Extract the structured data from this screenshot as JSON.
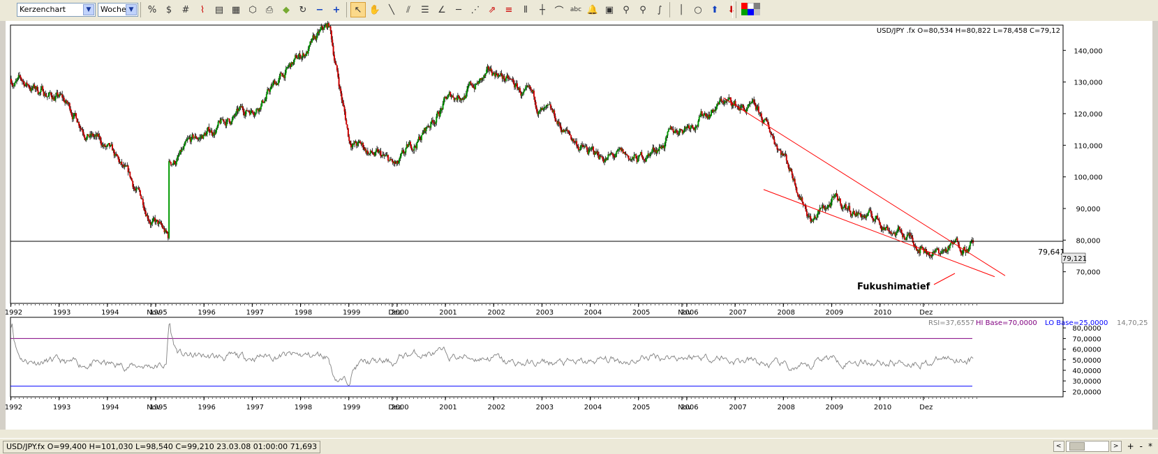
{
  "toolbar": {
    "chart_type": "Kerzenchart",
    "period": "Woche",
    "tools": [
      "percent-icon",
      "currency-icon",
      "grid-icon",
      "indicator-icon",
      "properties-icon",
      "template-icon",
      "open-icon",
      "print-icon",
      "color-icon",
      "refresh-icon",
      "zoom-minus-icon",
      "zoom-plus-icon",
      "cursor-icon",
      "hand-icon",
      "line-icon",
      "parallel-line-icon",
      "fibonacci-icon",
      "fan-icon",
      "arrow-tool-icon",
      "levels-icon",
      "vertical-lines-icon",
      "crosshair-icon",
      "arc-icon",
      "text-tool-icon",
      "alarm-icon",
      "calculator-icon",
      "zoom-in-icon",
      "zoom-area-icon",
      "freehand-icon",
      "vertical-line-icon",
      "circle-icon",
      "buy-arrow-icon",
      "sell-arrow-icon",
      "palette-icon"
    ]
  },
  "main_chart": {
    "info_line": "USD/JPY .fx O=80,534 H=80,822 L=78,458 C=79,12",
    "hline_label": "79,641",
    "last_price": "79,121",
    "annotation": "Fukushimatief",
    "colors": {
      "up": "#009900",
      "down": "#cc0000",
      "wick": "#000000",
      "trendline": "#ff0000",
      "hline": "#000000"
    }
  },
  "chart_data": [
    {
      "type": "candlestick",
      "title": "USD/JPY .fx",
      "ylim": [
        60000,
        148000
      ],
      "y_ticks": [
        "70,000",
        "80,000",
        "90,000",
        "100,000",
        "110,000",
        "120,000",
        "130,000",
        "140,000"
      ],
      "x_labels": [
        "1992",
        "1993",
        "1994",
        "Nov",
        "1995",
        "1996",
        "1997",
        "1998",
        "1999",
        "Dez",
        "2000",
        "2001",
        "2002",
        "2003",
        "2004",
        "2005",
        "Nov",
        "2006",
        "2007",
        "2008",
        "2009",
        "2010",
        "Dez"
      ],
      "horizontal_line": 79641,
      "trendlines": [
        {
          "from": [
            "2006-10",
            125000
          ],
          "to": [
            "2011-11",
            76000
          ]
        },
        {
          "from": [
            "2007-08",
            96000
          ],
          "to": [
            "2011-10",
            72000
          ]
        }
      ],
      "series": [
        {
          "x": [
            "1992",
            "1993",
            "1994",
            "1995-04",
            "1995",
            "1996",
            "1997",
            "1998-08",
            "1999",
            "2000",
            "2001",
            "2002-02",
            "2003",
            "2004",
            "2005",
            "2006",
            "2006-10",
            "2007-06",
            "2008",
            "2008-08",
            "2009",
            "2010",
            "2011-03",
            "2011-10"
          ],
          "values": [
            131000,
            125000,
            108000,
            80000,
            100000,
            113000,
            122000,
            147000,
            112000,
            102000,
            124000,
            133000,
            120000,
            107000,
            105000,
            117000,
            124000,
            120000,
            108000,
            87000,
            92000,
            86000,
            76000,
            79121
          ]
        }
      ]
    },
    {
      "type": "line",
      "title": "RSI",
      "info": {
        "rsi": "RSI=37,6557",
        "hi": "HI Base=70,0000",
        "lo": "LO Base=25,0000",
        "extra": "14,70,25"
      },
      "ylim": [
        15000,
        90000
      ],
      "y_ticks": [
        "20,0000",
        "30,0000",
        "40,0000",
        "50,0000",
        "60,0000",
        "70,0000",
        "80,0000"
      ],
      "hi_base": 70000,
      "lo_base": 25000,
      "colors": {
        "rsi": "#808080",
        "hi": "#800080",
        "lo": "#0000ff"
      }
    }
  ],
  "status": {
    "text": "USD/JPY.fx O=99,400 H=101,030 L=98,540 C=99,210  23.03.08 01:00:00 71,693"
  },
  "nav": {
    "prev": "<",
    "next": ">",
    "plus": "+",
    "minus": "-",
    "star": "*"
  }
}
